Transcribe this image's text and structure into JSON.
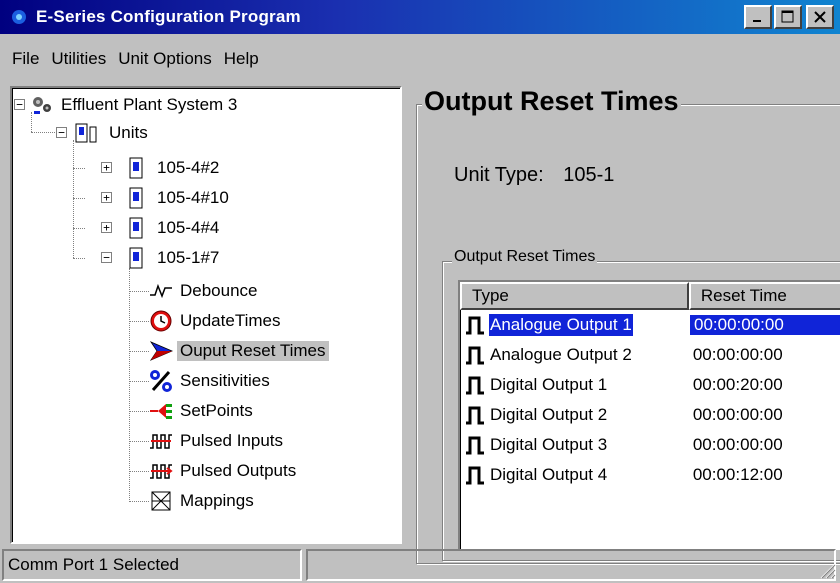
{
  "window": {
    "title": "E-Series Configuration Program",
    "minimize_icon": "minimize-icon",
    "maximize_icon": "maximize-icon",
    "close_icon": "close-icon"
  },
  "menu": [
    "File",
    "Utilities",
    "Unit Options",
    "Help"
  ],
  "tree": {
    "root": "Effluent Plant System 3",
    "units": "Units",
    "unit_items": [
      "105-4#2",
      "105-4#10",
      "105-4#4",
      "105-1#7"
    ],
    "children": [
      {
        "label": "Debounce",
        "icon": "waveform-icon"
      },
      {
        "label": "UpdateTimes",
        "icon": "clock-icon"
      },
      {
        "label": "Ouput Reset Times",
        "icon": "arrow-right-icon"
      },
      {
        "label": "Sensitivities",
        "icon": "percent-icon"
      },
      {
        "label": "SetPoints",
        "icon": "setpoint-icon"
      },
      {
        "label": "Pulsed Inputs",
        "icon": "pulsed-inputs-icon"
      },
      {
        "label": "Pulsed Outputs",
        "icon": "pulsed-outputs-icon"
      },
      {
        "label": "Mappings",
        "icon": "mappings-icon"
      }
    ],
    "selected": "Ouput Reset Times"
  },
  "main": {
    "title": "Output Reset Times",
    "unit_type_label": "Unit Type:",
    "unit_type_value": "105-1",
    "group_title": "Output Reset Times",
    "columns": [
      "Type",
      "Reset Time"
    ],
    "rows": [
      {
        "type": "Analogue Output 1",
        "time": "00:00:00:00",
        "selected": true
      },
      {
        "type": "Analogue Output 2",
        "time": "00:00:00:00"
      },
      {
        "type": "Digital Output 1",
        "time": "00:00:20:00"
      },
      {
        "type": "Digital Output 2",
        "time": "00:00:00:00"
      },
      {
        "type": "Digital Output 3",
        "time": "00:00:00:00"
      },
      {
        "type": "Digital Output 4",
        "time": "00:00:12:00"
      }
    ]
  },
  "status": {
    "text": "Comm Port 1 Selected",
    "second": ""
  },
  "colors": {
    "selection": "#1024d8",
    "title_start": "#000080",
    "title_end": "#1084d0"
  }
}
